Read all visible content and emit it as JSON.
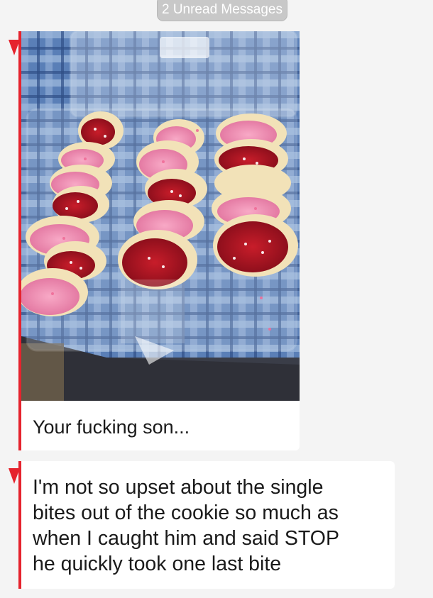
{
  "header": {
    "unread_label": "2 Unread Messages"
  },
  "messages": [
    {
      "type": "image",
      "image_description_icon": "photo-of-bitten-cookies-in-tray"
    },
    {
      "type": "text",
      "text": "Your fucking son..."
    },
    {
      "type": "text",
      "lines": [
        "I'm not so upset about the single",
        "bites out of the cookie so much as",
        "when I caught him and said STOP",
        "he quickly took one last bite"
      ]
    }
  ],
  "colors": {
    "accent": "#e5232d",
    "pill_bg": "#c8c8c8",
    "bubble_bg": "#ffffff",
    "page_bg": "#f4f4f4"
  }
}
